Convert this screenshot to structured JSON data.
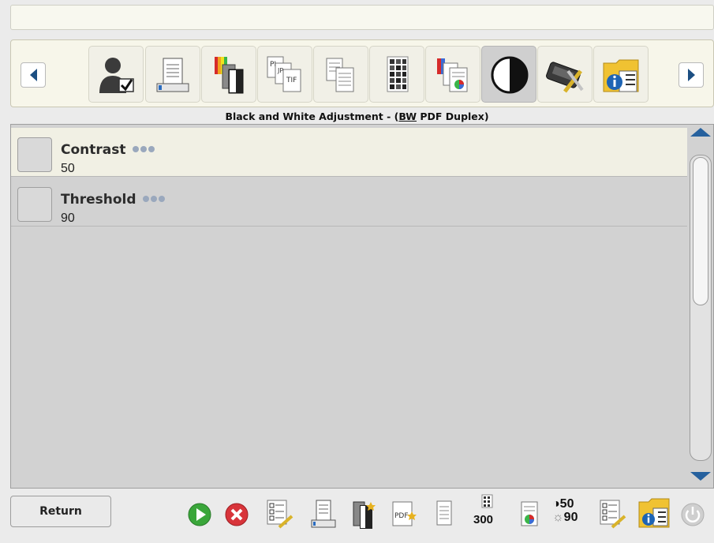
{
  "toolbar": {
    "tools": [
      {
        "name": "user-settings-icon"
      },
      {
        "name": "scanner-output-icon"
      },
      {
        "name": "color-pages-icon"
      },
      {
        "name": "file-types-icon"
      },
      {
        "name": "document-stack-icon"
      },
      {
        "name": "resolution-icon"
      },
      {
        "name": "color-detection-icon"
      },
      {
        "name": "contrast-icon",
        "active": true
      },
      {
        "name": "device-settings-icon"
      },
      {
        "name": "info-folder-icon"
      }
    ]
  },
  "section": {
    "title_prefix": "Black and White Adjustment - (",
    "title_underline": "BW",
    "title_suffix": " PDF Duplex)"
  },
  "settings": [
    {
      "label": "Contrast",
      "value": "50",
      "selected": true
    },
    {
      "label": "Threshold",
      "value": "90",
      "selected": false
    }
  ],
  "footer": {
    "return_label": "Return",
    "resolution": "300",
    "contrast_value": "50",
    "threshold_value": "90"
  },
  "colors": {
    "accent": "#26619e",
    "selected_row": "#f1f0e4",
    "pane": "#d2d2d2"
  }
}
